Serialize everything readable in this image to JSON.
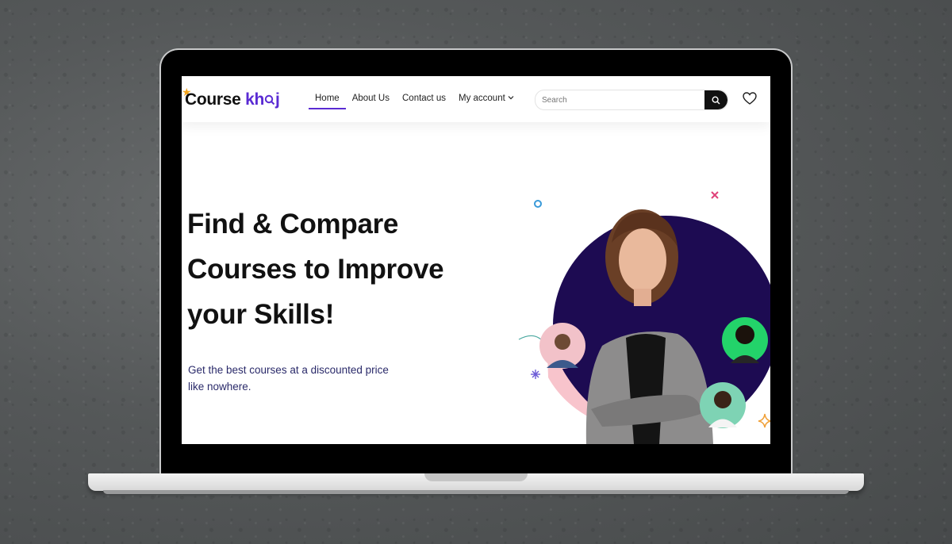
{
  "logo": {
    "text_course": "Course",
    "text_khoj": "kh",
    "text_end": "j"
  },
  "nav": {
    "items": [
      {
        "label": "Home",
        "active": true
      },
      {
        "label": "About Us",
        "active": false
      },
      {
        "label": "Contact us",
        "active": false
      },
      {
        "label": "My account",
        "active": false
      }
    ]
  },
  "search": {
    "placeholder": "Search",
    "value": ""
  },
  "hero": {
    "title_line1": "Find & Compare",
    "title_line2": "Courses to Improve",
    "title_line3": "your Skills!",
    "subtitle_line1": "Get the best courses at a discounted price",
    "subtitle_line2": "like nowhere."
  },
  "icons": [
    "search-icon",
    "heart-icon",
    "chevron-down-icon",
    "magnifier-logo-icon",
    "star-icon"
  ],
  "colors": {
    "brand_purple": "#5a2bd3",
    "dark_blob": "#1d0b52",
    "pink_blob": "#f8c4cc",
    "text_dark": "#111111"
  }
}
